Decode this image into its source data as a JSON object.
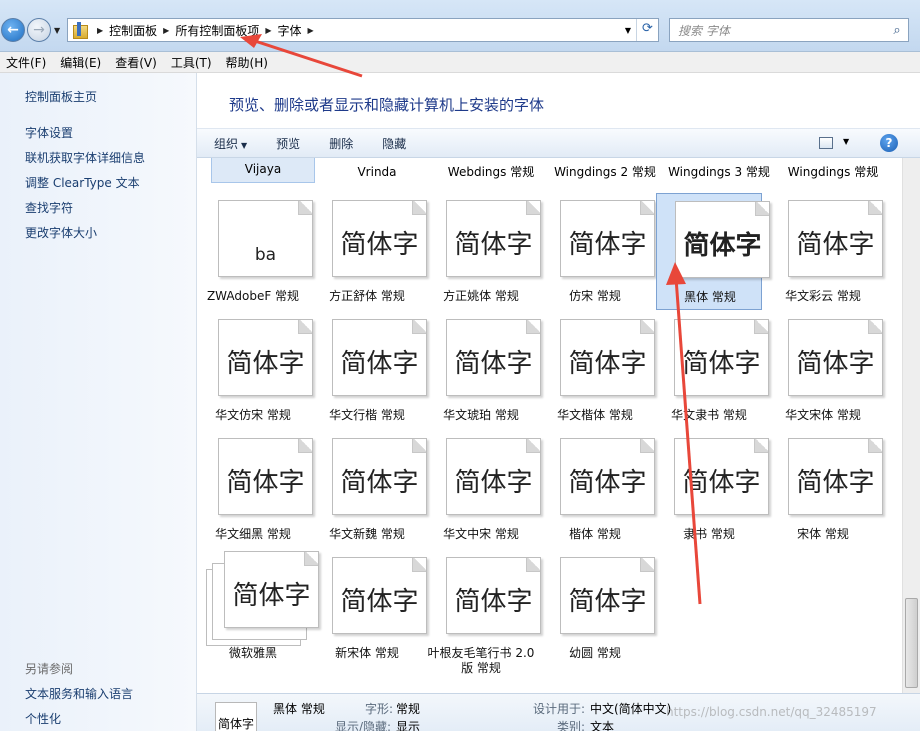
{
  "address": {
    "crumbs": [
      "控制面板",
      "所有控制面板项",
      "字体"
    ],
    "search_placeholder": "搜索 字体"
  },
  "menu": [
    "文件(F)",
    "编辑(E)",
    "查看(V)",
    "工具(T)",
    "帮助(H)"
  ],
  "left_pane": {
    "home": "控制面板主页",
    "links": [
      "字体设置",
      "联机获取字体详细信息",
      "调整 ClearType 文本",
      "查找字符",
      "更改字体大小"
    ],
    "see_also_heading": "另请参阅",
    "see_also": [
      "文本服务和输入语言",
      "个性化"
    ]
  },
  "main": {
    "title": "预览、删除或者显示和隐藏计算机上安装的字体",
    "toolbar": {
      "organize": "组织",
      "preview": "预览",
      "delete": "删除",
      "hide": "隐藏"
    }
  },
  "top_row": [
    "Vijaya",
    "Vrinda",
    "Webdings 常规",
    "Wingdings 2 常规",
    "Wingdings 3 常规",
    "Wingdings 常规"
  ],
  "sample_text": "简体字",
  "fonts": [
    {
      "label": "ZWAdobeF 常规",
      "sample": "ba"
    },
    {
      "label": "方正舒体 常规",
      "sample": "简体字"
    },
    {
      "label": "方正姚体 常规",
      "sample": "简体字"
    },
    {
      "label": "仿宋 常规",
      "sample": "简体字"
    },
    {
      "label": "黑体 常规",
      "sample": "简体字",
      "selected": true
    },
    {
      "label": "华文彩云 常规",
      "sample": "简体字"
    },
    {
      "label": "华文仿宋 常规",
      "sample": "简体字"
    },
    {
      "label": "华文行楷 常规",
      "sample": "简体字"
    },
    {
      "label": "华文琥珀 常规",
      "sample": "简体字"
    },
    {
      "label": "华文楷体 常规",
      "sample": "简体字"
    },
    {
      "label": "华文隶书 常规",
      "sample": "简体字"
    },
    {
      "label": "华文宋体 常规",
      "sample": "简体字"
    },
    {
      "label": "华文细黑 常规",
      "sample": "简体字"
    },
    {
      "label": "华文新魏 常规",
      "sample": "简体字"
    },
    {
      "label": "华文中宋 常规",
      "sample": "简体字"
    },
    {
      "label": "楷体 常规",
      "sample": "简体字"
    },
    {
      "label": "隶书 常规",
      "sample": "简体字"
    },
    {
      "label": "宋体 常规",
      "sample": "简体字"
    },
    {
      "label": "微软雅黑",
      "sample": "简体字",
      "stack": true
    },
    {
      "label": "新宋体 常规",
      "sample": "简体字"
    },
    {
      "label": "叶根友毛笔行书 2.0版 常规",
      "sample": "简体字"
    },
    {
      "label": "幼圆 常规",
      "sample": "简体字"
    }
  ],
  "details": {
    "thumb": "简体字",
    "name": "黑体 常规",
    "style_key": "字形:",
    "style_val": "常规",
    "show_key": "显示/隐藏:",
    "show_val": "显示",
    "design_key": "设计用于:",
    "design_val": "中文(简体中文)",
    "category_key": "类别:",
    "category_val": "文本"
  },
  "watermark": "https://blog.csdn.net/qq_32485197",
  "colors": {
    "annotation_arrow": "#e8473a",
    "title_blue": "#1e3a8a",
    "selection": "#cfe2f8"
  }
}
